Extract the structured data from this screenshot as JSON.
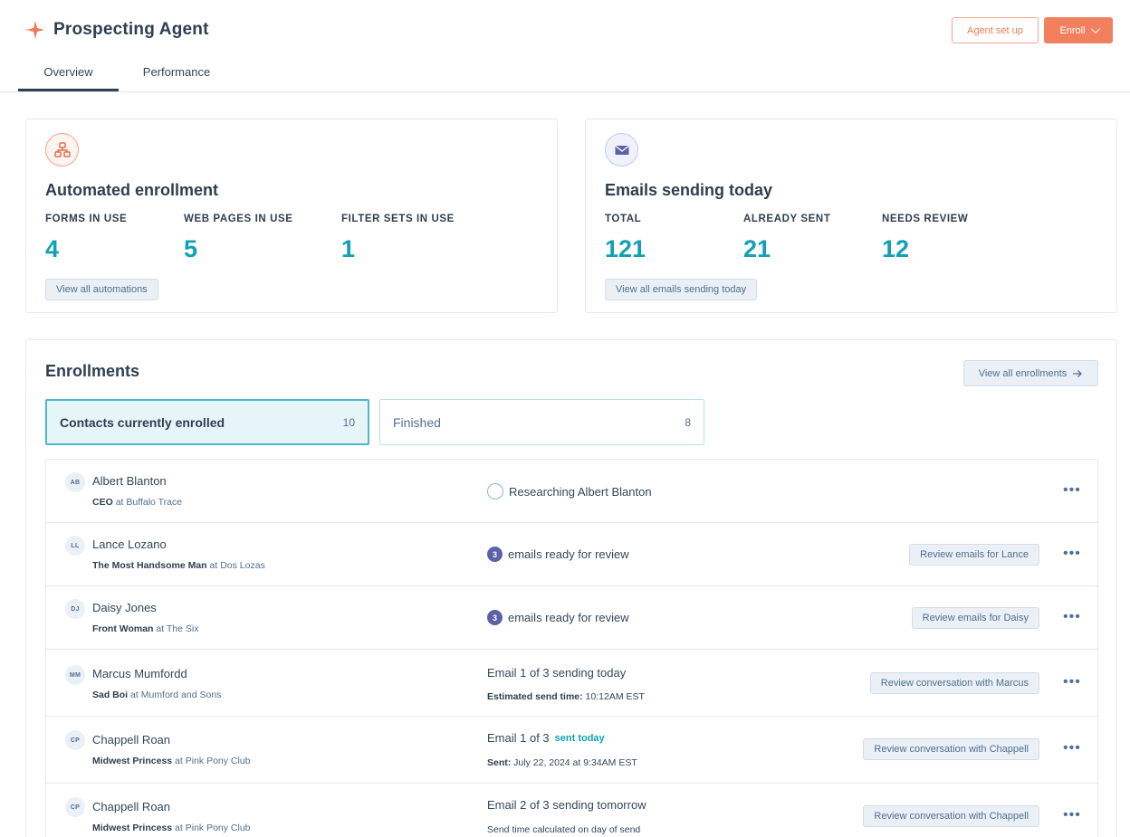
{
  "header": {
    "app_title": "Prospecting Agent",
    "setup_label": "Agent set up",
    "enroll_label": "Enroll",
    "tabs": [
      {
        "label": "Overview",
        "active": true
      },
      {
        "label": "Performance",
        "active": false
      }
    ]
  },
  "colors": {
    "brand_orange": "#f2805f",
    "metric_teal": "#12a1b4",
    "active_tab_border": "#4cb8c8",
    "badge_purple": "#5c62a6"
  },
  "cards": {
    "automation": {
      "icon": "workflow-icon",
      "title": "Automated enrollment",
      "stats": [
        {
          "label": "FORMS IN USE",
          "value": "4"
        },
        {
          "label": "WEB PAGES IN USE",
          "value": "5"
        },
        {
          "label": "FILTER SETS IN USE",
          "value": "1"
        }
      ],
      "link_label": "View all automations"
    },
    "emails": {
      "icon": "envelope-icon",
      "title": "Emails sending today",
      "stats": [
        {
          "label": "TOTAL",
          "value": "121"
        },
        {
          "label": "ALREADY SENT",
          "value": "21"
        },
        {
          "label": "NEEDS REVIEW",
          "value": "12"
        }
      ],
      "link_label": "View all emails sending today"
    }
  },
  "enrollments": {
    "title": "Enrollments",
    "view_all_label": "View all enrollments",
    "segments": [
      {
        "label": "Contacts currently enrolled",
        "count": "10"
      },
      {
        "label": "Finished",
        "count": "8"
      }
    ],
    "rows": [
      {
        "initials": "AB",
        "name": "Albert Blanton",
        "title": "CEO",
        "at": "at",
        "company": "Buffalo Trace",
        "status_type": "researching",
        "status_text": "Researching Albert Blanton"
      },
      {
        "initials": "LL",
        "name": "Lance Lozano",
        "title": "The Most Handsome Man",
        "at": "at",
        "company": "Dos Lozas",
        "status_type": "review",
        "badge": "3",
        "status_text": "emails ready for review",
        "action": "Review emails for Lance"
      },
      {
        "initials": "DJ",
        "name": "Daisy Jones",
        "title": "Front Woman",
        "at": "at",
        "company": "The Six",
        "status_type": "review",
        "badge": "3",
        "status_text": "emails ready for review",
        "action": "Review emails for Daisy"
      },
      {
        "initials": "MM",
        "name": "Marcus Mumfordd",
        "title": "Sad Boi",
        "at": "at",
        "company": "Mumford and Sons",
        "status_type": "sending",
        "status_text": "Email 1 of 3 sending today",
        "sub_label": "Estimated send time:",
        "sub_value": "10:12AM EST",
        "action": "Review conversation with Marcus"
      },
      {
        "initials": "CP",
        "name": "Chappell Roan",
        "title": "Midwest Princess",
        "at": "at",
        "company": "Pink Pony Club",
        "status_type": "sent",
        "status_text": "Email 1 of 3",
        "status_highlight": "sent today",
        "sub_label": "Sent:",
        "sub_value": "July 22, 2024 at 9:34AM EST",
        "action": "Review conversation with Chappell"
      },
      {
        "initials": "CP",
        "name": "Chappell Roan",
        "title": "Midwest Princess",
        "at": "at",
        "company": "Pink Pony Club",
        "status_type": "scheduled",
        "status_text": "Email 2 of 3 sending tomorrow",
        "sub_value": "Send time calculated on day of send",
        "action": "Review conversation with Chappell"
      }
    ],
    "more_label": "•••"
  }
}
